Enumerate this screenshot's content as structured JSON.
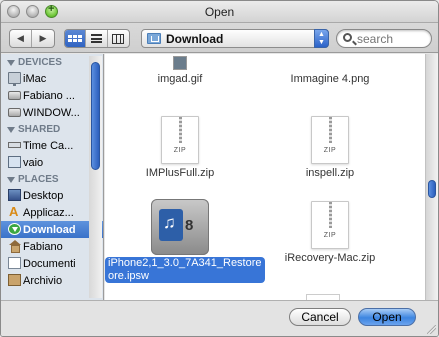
{
  "window": {
    "title": "Open"
  },
  "toolbar": {
    "back_icon": "back-arrow-icon",
    "forward_icon": "forward-arrow-icon",
    "location": "Download",
    "search_placeholder": "search"
  },
  "sidebar": {
    "sections": [
      {
        "label": "DEVICES",
        "items": [
          {
            "label": "iMac",
            "icon": "imac-icon"
          },
          {
            "label": "Fabiano ...",
            "icon": "disk-icon"
          },
          {
            "label": "WINDOW...",
            "icon": "disk-icon"
          }
        ]
      },
      {
        "label": "SHARED",
        "items": [
          {
            "label": "Time Ca...",
            "icon": "network-disk-icon"
          },
          {
            "label": "vaio",
            "icon": "computer-icon"
          }
        ]
      },
      {
        "label": "PLACES",
        "items": [
          {
            "label": "Desktop",
            "icon": "desktop-icon"
          },
          {
            "label": "Applicaz...",
            "icon": "applications-icon"
          },
          {
            "label": "Download",
            "icon": "download-icon",
            "selected": true
          },
          {
            "label": "Fabiano",
            "icon": "home-icon"
          },
          {
            "label": "Documenti",
            "icon": "documents-icon"
          },
          {
            "label": "Archivio",
            "icon": "archive-icon"
          }
        ]
      }
    ]
  },
  "files": [
    {
      "name": "imgad.gif",
      "icon": "gif-icon"
    },
    {
      "name": "Immagine 4.png",
      "icon": "png-icon"
    },
    {
      "name": "IMPlusFull.zip",
      "icon": "zip-icon",
      "badge": "ZIP"
    },
    {
      "name": "inspell.zip",
      "icon": "zip-icon",
      "badge": "ZIP"
    },
    {
      "name_line1": "iPhone2,1_3.0_7A341_Restore",
      "name_line2": "ore.ipsw",
      "icon": "itunes-restore-icon",
      "badge": "8",
      "selected": true
    },
    {
      "name": "iRecovery-Mac.zip",
      "icon": "zip-icon",
      "badge": "ZIP"
    }
  ],
  "buttons": {
    "cancel": "Cancel",
    "open": "Open"
  },
  "colors": {
    "selection": "#3875d7",
    "sidebar_bg": "#dde4ec",
    "accent": "#2c5fbd"
  }
}
